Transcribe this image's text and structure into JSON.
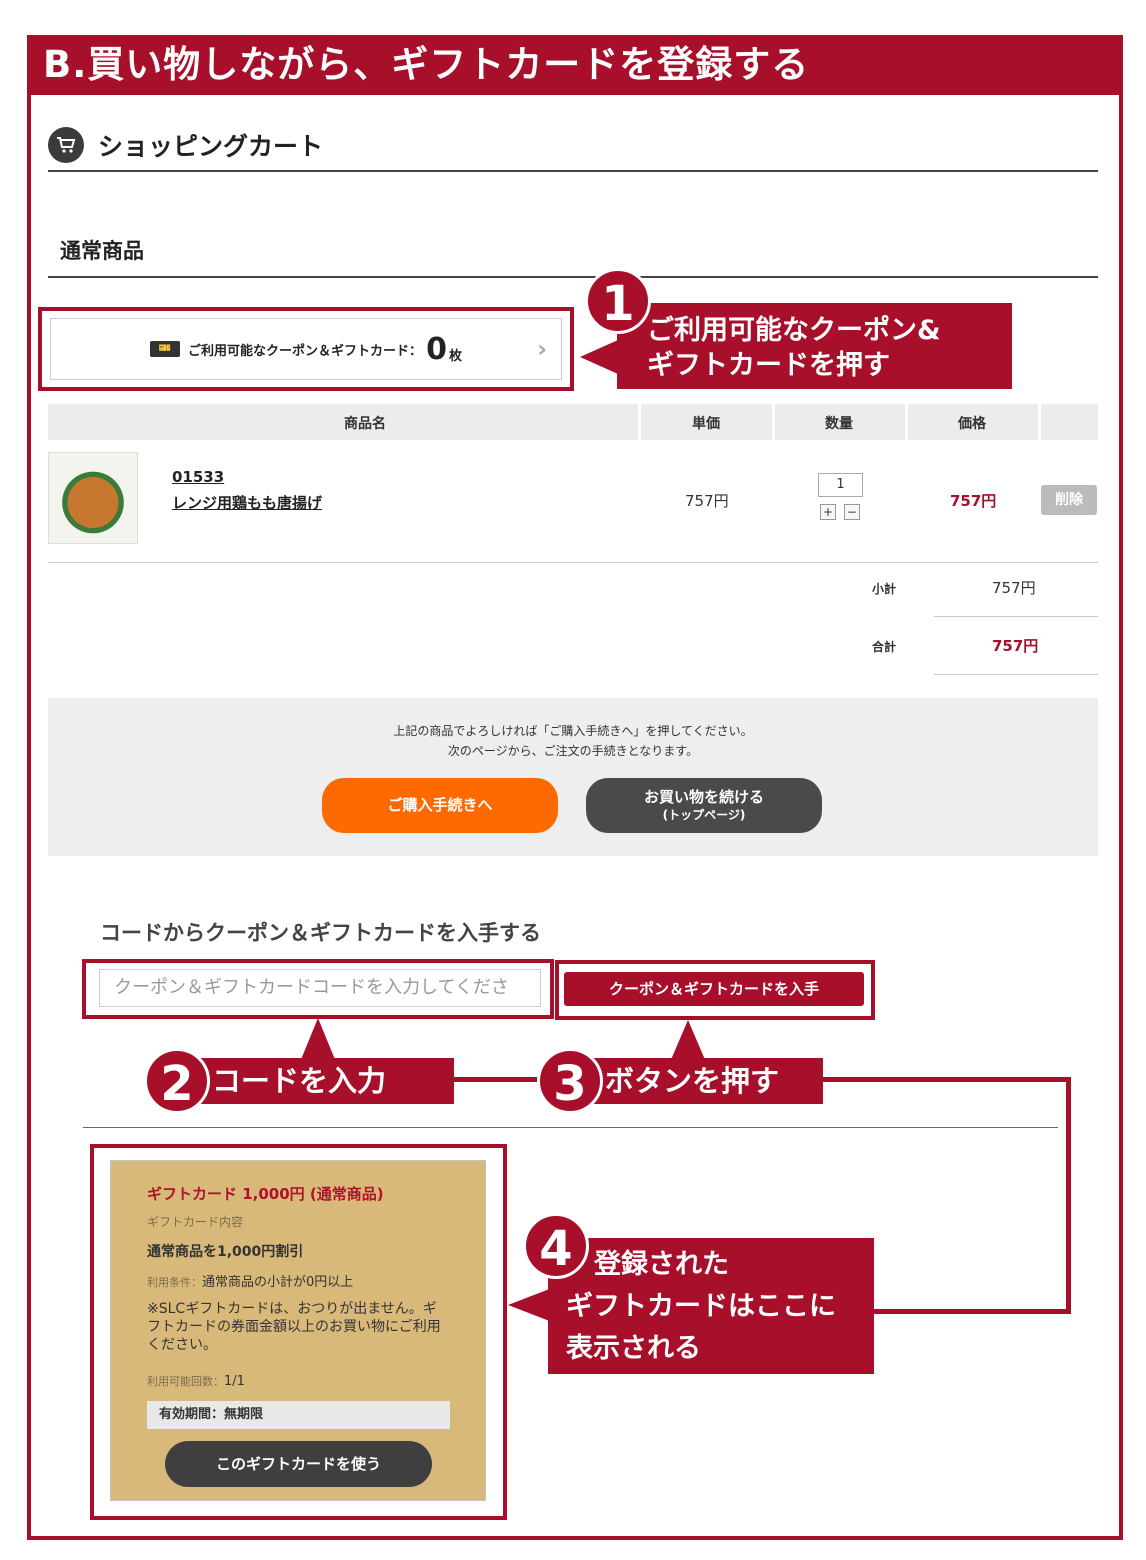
{
  "banner": {
    "title": "B.買い物しながら、ギフトカードを登録する"
  },
  "cart": {
    "title": "ショッピングカート",
    "section": "通常商品"
  },
  "coupon_link": {
    "label": "ご利用可能なクーポン＆ギフトカード：",
    "count": "0",
    "unit": "枚"
  },
  "table": {
    "headers": [
      "商品名",
      "単価",
      "数量",
      "価格"
    ],
    "rows": [
      {
        "code": "01533",
        "name": "レンジ用鶏もも唐揚げ",
        "unit_price": "757円",
        "qty": "1",
        "price": "757円",
        "delete_label": "削除"
      }
    ]
  },
  "summary": {
    "subtotal_label": "小計",
    "subtotal": "757円",
    "total_label": "合計",
    "total": "757円"
  },
  "checkout": {
    "message_line1": "上記の商品でよろしければ「ご購入手続きへ」を押してください。",
    "message_line2": "次のページから、ご注文の手続きとなります。",
    "purchase_label": "ご購入手続きへ",
    "continue_label": "お買い物を続ける",
    "continue_sub": "(トップページ)"
  },
  "code_section": {
    "title": "コードからクーポン＆ギフトカードを入手する",
    "placeholder": "クーポン＆ギフトカードコードを入力してくださ",
    "button_label": "クーポン＆ギフトカードを入手"
  },
  "gift_card": {
    "title": "ギフトカード 1,000円 (通常商品)",
    "content_label": "ギフトカード内容",
    "discount": "通常商品を1,000円割引",
    "condition_label": "利用条件：",
    "condition": "通常商品の小計が0円以上",
    "note": "※SLCギフトカードは、おつりが出ません。ギフトカードの券面金額以上のお買い物にご利用ください。",
    "uses_label": "利用可能回数：",
    "uses": "1/1",
    "validity": "有効期間：無期限",
    "use_button": "このギフトカードを使う"
  },
  "callouts": {
    "c1": {
      "num": "1",
      "line1": "ご利用可能なクーポン&",
      "line2": "ギフトカードを押す"
    },
    "c2": {
      "num": "2",
      "text": "コードを入力"
    },
    "c3": {
      "num": "3",
      "text": "ボタンを押す"
    },
    "c4": {
      "num": "4",
      "line1": "登録された",
      "line2": "ギフトカードはここに",
      "line3": "表示される"
    }
  },
  "colors": {
    "accent": "#a80f2a",
    "orange": "#ff6a00",
    "dark_button": "#4a4a4a",
    "gift_bg": "#d9b97a"
  }
}
